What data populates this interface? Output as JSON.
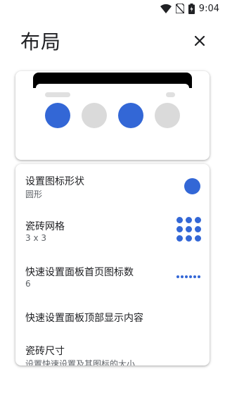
{
  "status_bar": {
    "time": "9:04",
    "icons": [
      "wifi-icon",
      "no-sim-icon",
      "battery-charging-icon"
    ]
  },
  "header": {
    "title": "布局",
    "close_icon": "close-icon"
  },
  "preview": {
    "tiles": [
      {
        "state": "on",
        "color": "#3367d6"
      },
      {
        "state": "off",
        "color": "#dadada"
      },
      {
        "state": "on",
        "color": "#3367d6"
      },
      {
        "state": "off",
        "color": "#dadada"
      }
    ]
  },
  "settings": {
    "items": [
      {
        "title": "设置图标形状",
        "subtitle": "圆形",
        "control": "circle-shape-icon"
      },
      {
        "title": "瓷砖网格",
        "subtitle": "3 x 3",
        "control": "grid-3x3-icon"
      },
      {
        "title": "快速设置面板首页图标数",
        "subtitle": "6",
        "control": "six-dots-icon"
      },
      {
        "title": "快速设置面板顶部显示内容",
        "subtitle": "",
        "control": ""
      },
      {
        "title": "瓷砖尺寸",
        "subtitle": "设置快速设置及其图标的大小",
        "control": ""
      }
    ]
  },
  "colors": {
    "accent": "#3367d6",
    "tile_off": "#dadada",
    "text_primary": "#202124",
    "text_secondary": "#5f6368"
  }
}
